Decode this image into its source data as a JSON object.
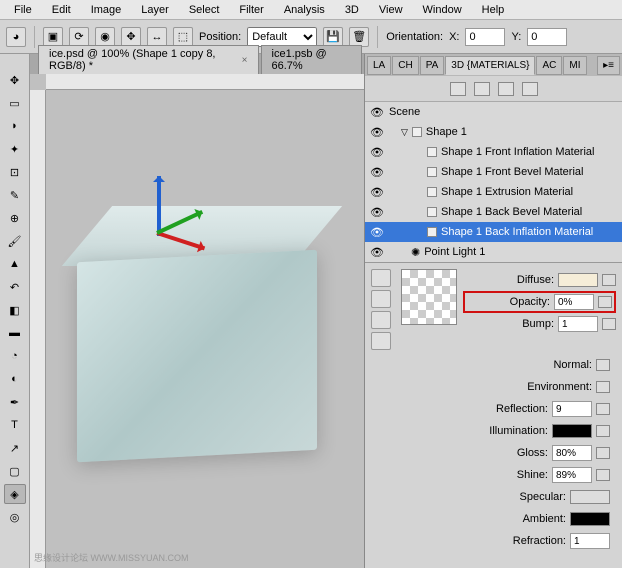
{
  "menu": [
    "File",
    "Edit",
    "Image",
    "Layer",
    "Select",
    "Filter",
    "Analysis",
    "3D",
    "View",
    "Window",
    "Help"
  ],
  "optbar": {
    "position_label": "Position:",
    "position_value": "Default",
    "orientation_label": "Orientation:",
    "x_label": "X:",
    "x_val": "0",
    "y_label": "Y:",
    "y_val": "0"
  },
  "tabs": [
    {
      "label": "ice.psd @ 100% (Shape 1 copy 8, RGB/8) *",
      "active": true
    },
    {
      "label": "ice1.psb @ 66.7%",
      "active": false
    }
  ],
  "panel_tabs": [
    "LA",
    "CH",
    "PA",
    "3D {MATERIALS}",
    "AC",
    "MI"
  ],
  "scene": {
    "root": "Scene",
    "shape": "Shape 1",
    "items": [
      "Shape 1 Front Inflation Material",
      "Shape 1 Front Bevel Material",
      "Shape 1 Extrusion Material",
      "Shape 1 Back Bevel Material",
      "Shape 1 Back Inflation Material"
    ],
    "light": "Point Light 1"
  },
  "material": {
    "diffuse_label": "Diffuse:",
    "opacity_label": "Opacity:",
    "opacity_val": "0%",
    "bump_label": "Bump:",
    "bump_val": "1",
    "normal_label": "Normal:",
    "environment_label": "Environment:",
    "reflection_label": "Reflection:",
    "reflection_val": "9",
    "illumination_label": "Illumination:",
    "gloss_label": "Gloss:",
    "gloss_val": "80%",
    "shine_label": "Shine:",
    "shine_val": "89%",
    "specular_label": "Specular:",
    "ambient_label": "Ambient:",
    "refraction_label": "Refraction:",
    "refraction_val": "1"
  },
  "watermark": "思缘设计论坛 WWW.MISSYUAN.COM"
}
